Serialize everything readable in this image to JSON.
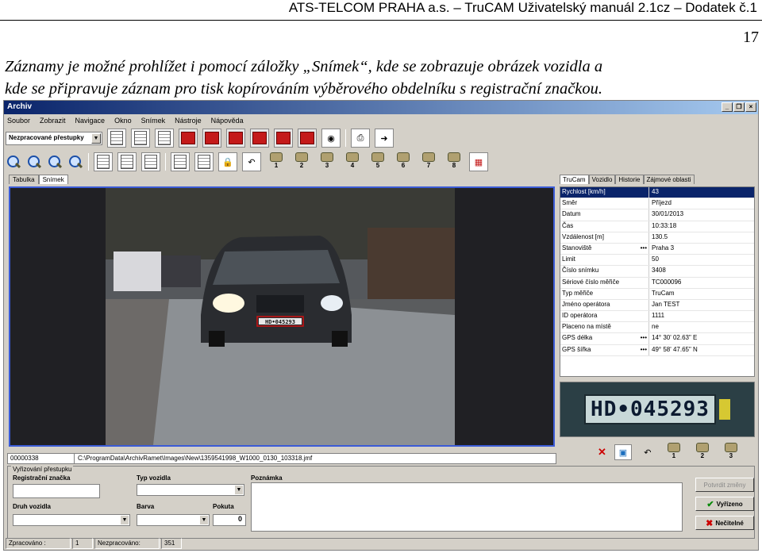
{
  "doc": {
    "header": "ATS-TELCOM PRAHA a.s. – TruCAM Uživatelský manuál 2.1cz – Dodatek č.1",
    "page_number": "17",
    "para_line1": "Záznamy je možné prohlížet i pomocí záložky „Snímek“, kde se zobrazuje obrázek vozidla a",
    "para_line2": "kde se připravuje záznam pro tisk kopírováním výběrového obdelníku s registrační značkou."
  },
  "window": {
    "title": "Archiv",
    "buttons": [
      "_",
      "❐",
      "×"
    ]
  },
  "menu": [
    "Soubor",
    "Zobrazit",
    "Navigace",
    "Okno",
    "Snímek",
    "Nástroje",
    "Nápověda"
  ],
  "toolbar": {
    "filter_selected": "Nezpracované přestupky",
    "camera_numbers": [
      "1",
      "2",
      "3",
      "4",
      "5",
      "6",
      "7",
      "8"
    ]
  },
  "tabs": [
    "Tabulka",
    "Snímek"
  ],
  "right_tabs": [
    "TruCam",
    "Vozidlo",
    "Historie",
    "Zájmové oblasti"
  ],
  "properties": [
    {
      "k": "Rychlost [km/h]",
      "v": "43"
    },
    {
      "k": "Směr",
      "v": "Příjezd"
    },
    {
      "k": "Datum",
      "v": "30/01/2013"
    },
    {
      "k": "Čas",
      "v": "10:33:18"
    },
    {
      "k": "Vzdálenost [m]",
      "v": "130.5"
    },
    {
      "k": "Stanoviště",
      "v": "Praha 3"
    },
    {
      "k": "Limit",
      "v": "50"
    },
    {
      "k": "Číslo snímku",
      "v": "3408"
    },
    {
      "k": "Sériové číslo měřiče",
      "v": "TC000096"
    },
    {
      "k": "Typ měřiče",
      "v": "TruCam"
    },
    {
      "k": "Jméno operátora",
      "v": "Jan TEST"
    },
    {
      "k": "ID operátora",
      "v": "1111"
    },
    {
      "k": "Placeno na místě",
      "v": "ne"
    },
    {
      "k": "GPS délka",
      "v": "14° 30' 02.63\" E"
    },
    {
      "k": "GPS šířka",
      "v": "49° 58' 47.65\" N"
    }
  ],
  "image": {
    "plate_text": "HD•045293",
    "counter": "00000338",
    "path": "C:\\ProgramData\\ArchivRamet\\Images\\New\\1359541998_W1000_0130_103318.jmf"
  },
  "plate_zoom": "HD•045293",
  "right_camera_numbers": [
    "1",
    "2",
    "3"
  ],
  "form": {
    "legend": "Vyřizování přestupku",
    "reg_label": "Registrační značka",
    "type_label": "Typ vozidla",
    "note_label": "Poznámka",
    "kind_label": "Druh vozidla",
    "color_label": "Barva",
    "fine_label": "Pokuta",
    "fine_value": "0",
    "btn_confirm": "Potvrdit změny",
    "btn_done": "Vyřízeno",
    "btn_invalid": "Nečitelné"
  },
  "status": {
    "processed_label": "Zpracováno :",
    "processed_value": "1",
    "unprocessed_label": "Nezpracováno:",
    "unprocessed_value": "351"
  }
}
